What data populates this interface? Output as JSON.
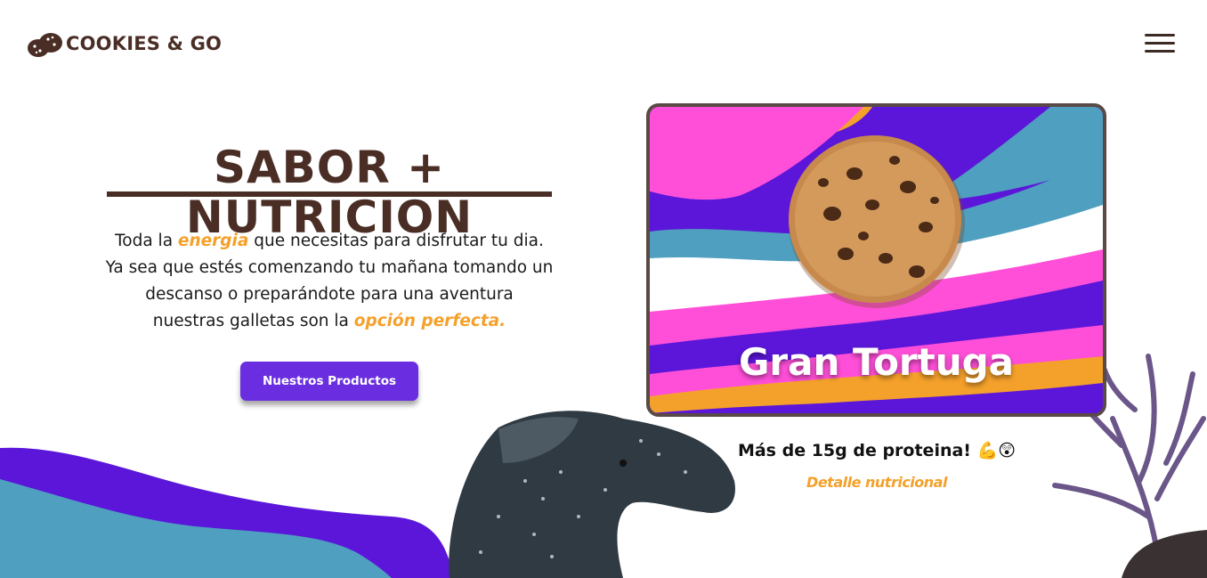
{
  "brand": {
    "name": "COOKIES & GO",
    "logo_icon": "cookies-icon"
  },
  "header": {
    "menu_icon": "hamburger-menu-icon"
  },
  "hero": {
    "title": "SABOR + NUTRICION",
    "line1_pre": "Toda la ",
    "line1_hl": "energia",
    "line1_post": " que necesitas para disfrutar tu dia.",
    "line2": "Ya sea que estés comenzando tu mañana tomando un",
    "line3": "descanso o preparándote para una aventura",
    "line4_pre": "nuestras galletas son la ",
    "line4_hl": "opción perfecta.",
    "cta_label": "Nuestros Productos"
  },
  "product": {
    "name": "Gran Tortuga",
    "protein_text": "Más de 15g de proteina! 💪😲",
    "detail_link": "Detalle nutricional"
  },
  "colors": {
    "brand_brown": "#4a2e25",
    "accent_orange": "#f4a12b",
    "purple": "#5b16d9",
    "button_purple": "#6a2ee0",
    "pink": "#ff4fd8",
    "teal": "#4f9fc0"
  }
}
